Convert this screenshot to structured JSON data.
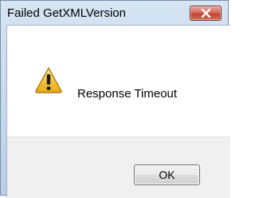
{
  "window": {
    "title": "Failed GetXMLVersion"
  },
  "titlebar": {
    "close_icon": "close-icon"
  },
  "content": {
    "icon": "warning-icon",
    "message": "Response Timeout"
  },
  "buttons": {
    "ok_label": "OK"
  },
  "colors": {
    "close_button": "#c34434",
    "warning_fill": "#f5c518",
    "footer_bg": "#f0f0f0"
  }
}
